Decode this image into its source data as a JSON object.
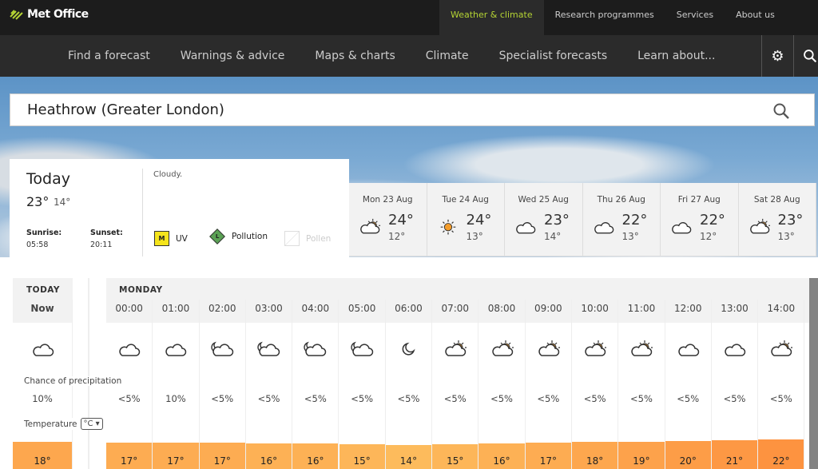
{
  "header": {
    "logo": "Met Office",
    "top_links": [
      "Weather & climate",
      "Research programmes",
      "Services",
      "About us"
    ],
    "active_top": 0,
    "nav": [
      "Find a forecast",
      "Warnings & advice",
      "Maps & charts",
      "Climate",
      "Specialist forecasts",
      "Learn about..."
    ]
  },
  "search": {
    "value": "Heathrow (Greater London)"
  },
  "today": {
    "title": "Today",
    "max": "23°",
    "min": "14°",
    "sunrise_label": "Sunrise:",
    "sunrise": "05:58",
    "sunset_label": "Sunset:",
    "sunset": "20:11",
    "summary": "Cloudy.",
    "uv_level": "M",
    "uv_label": "UV",
    "pollution_level": "L",
    "pollution_label": "Pollution",
    "pollen_label": "Pollen"
  },
  "days": [
    {
      "date": "Mon 23 Aug",
      "icon": "sun-cloud",
      "max": "24°",
      "min": "12°"
    },
    {
      "date": "Tue 24 Aug",
      "icon": "sun",
      "max": "24°",
      "min": "13°"
    },
    {
      "date": "Wed 25 Aug",
      "icon": "cloud",
      "max": "23°",
      "min": "14°"
    },
    {
      "date": "Thu 26 Aug",
      "icon": "cloud",
      "max": "22°",
      "min": "13°"
    },
    {
      "date": "Fri 27 Aug",
      "icon": "cloud",
      "max": "22°",
      "min": "12°"
    },
    {
      "date": "Sat 28 Aug",
      "icon": "sun-cloud",
      "max": "23°",
      "min": "13°"
    }
  ],
  "hourly": {
    "today_label": "TODAY",
    "day_label": "MONDAY",
    "precip_label": "Chance of precipitation",
    "temp_label": "Temperature",
    "temp_unit": "°C ▾",
    "now": {
      "time": "Now",
      "icon": "cloud",
      "precip": "10%",
      "temp": "18°"
    },
    "hours": [
      {
        "time": "00:00",
        "icon": "cloud",
        "precip": "<5%",
        "temp": "17°"
      },
      {
        "time": "01:00",
        "icon": "cloud",
        "precip": "10%",
        "temp": "17°"
      },
      {
        "time": "02:00",
        "icon": "moon-cloud",
        "precip": "<5%",
        "temp": "17°"
      },
      {
        "time": "03:00",
        "icon": "moon-cloud",
        "precip": "<5%",
        "temp": "16°"
      },
      {
        "time": "04:00",
        "icon": "moon-cloud",
        "precip": "<5%",
        "temp": "16°"
      },
      {
        "time": "05:00",
        "icon": "moon-cloud",
        "precip": "<5%",
        "temp": "15°"
      },
      {
        "time": "06:00",
        "icon": "moon",
        "precip": "<5%",
        "temp": "14°"
      },
      {
        "time": "07:00",
        "icon": "sun-cloud",
        "precip": "<5%",
        "temp": "15°"
      },
      {
        "time": "08:00",
        "icon": "sun-cloud",
        "precip": "<5%",
        "temp": "16°"
      },
      {
        "time": "09:00",
        "icon": "sun-cloud",
        "precip": "<5%",
        "temp": "17°"
      },
      {
        "time": "10:00",
        "icon": "sun-cloud",
        "precip": "<5%",
        "temp": "18°"
      },
      {
        "time": "11:00",
        "icon": "sun-cloud",
        "precip": "<5%",
        "temp": "19°"
      },
      {
        "time": "12:00",
        "icon": "cloud",
        "precip": "<5%",
        "temp": "20°"
      },
      {
        "time": "13:00",
        "icon": "cloud",
        "precip": "<5%",
        "temp": "21°"
      },
      {
        "time": "14:00",
        "icon": "sun-cloud",
        "precip": "<5%",
        "temp": "22°"
      }
    ]
  },
  "colors": {
    "accent": "#b4d334",
    "uv_moderate": "#f5e41b",
    "pollution_low": "#5aa154",
    "sun": "#f39c2b",
    "temp_low": "#fdbb5c",
    "temp_high": "#fb9540"
  }
}
